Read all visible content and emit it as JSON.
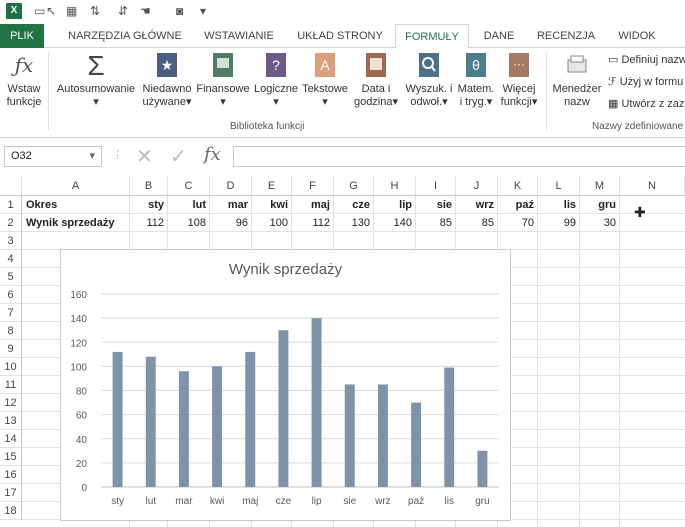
{
  "app": {
    "logo": "X"
  },
  "quick_access": [
    "save-icon",
    "undo-icon",
    "format-icon",
    "sort-asc-icon",
    "sort-desc-icon",
    "touch-icon",
    "camera-icon",
    "customize-icon"
  ],
  "tabs": [
    {
      "label": "PLIK"
    },
    {
      "label": "NARZĘDZIA GŁÓWNE"
    },
    {
      "label": "WSTAWIANIE"
    },
    {
      "label": "UKŁAD STRONY"
    },
    {
      "label": "FORMUŁY"
    },
    {
      "label": "DANE"
    },
    {
      "label": "RECENZJA"
    },
    {
      "label": "WIDOK"
    }
  ],
  "ribbon": {
    "insert_function": {
      "line1": "Wstaw",
      "line2": "funkcje"
    },
    "autosum": {
      "line1": "Autosumowanie"
    },
    "recent": {
      "line1": "Niedawno",
      "line2": "używane"
    },
    "financial": {
      "line1": "Finansowe"
    },
    "logical": {
      "line1": "Logiczne"
    },
    "text": {
      "line1": "Tekstowe"
    },
    "datetime": {
      "line1": "Data i",
      "line2": "godzina"
    },
    "lookup": {
      "line1": "Wyszuk. i",
      "line2": "odwoł."
    },
    "math": {
      "line1": "Matem.",
      "line2": "i tryg."
    },
    "more": {
      "line1": "Więcej",
      "line2": "funkcji"
    },
    "library_group": "Biblioteka funkcji",
    "name_manager": {
      "line1": "Menedżer",
      "line2": "nazw"
    },
    "define_name": "Definiuj nazw",
    "use_in_formula": "Użyj w formu",
    "create_from": "Utwórz z zaz",
    "names_group": "Nazwy zdefiniowane"
  },
  "formula_bar": {
    "name_box": "O32",
    "fx": "fx",
    "value": ""
  },
  "columns": [
    "A",
    "B",
    "C",
    "D",
    "E",
    "F",
    "G",
    "H",
    "I",
    "J",
    "K",
    "L",
    "M",
    "N"
  ],
  "rows": [
    "1",
    "2",
    "3",
    "4",
    "5",
    "6",
    "7",
    "8",
    "9",
    "10",
    "11",
    "12",
    "13",
    "14",
    "15",
    "16",
    "17",
    "18"
  ],
  "sheet": {
    "row1": [
      "Okres",
      "sty",
      "lut",
      "mar",
      "kwi",
      "maj",
      "cze",
      "lip",
      "sie",
      "wrz",
      "paź",
      "lis",
      "gru"
    ],
    "row2": [
      "Wynik sprzedaży",
      "112",
      "108",
      "96",
      "100",
      "112",
      "130",
      "140",
      "85",
      "85",
      "70",
      "99",
      "30"
    ]
  },
  "chart_data": {
    "type": "bar",
    "title": "Wynik sprzedaży",
    "categories": [
      "sty",
      "lut",
      "mar",
      "kwi",
      "maj",
      "cze",
      "lip",
      "sie",
      "wrz",
      "paź",
      "lis",
      "gru"
    ],
    "values": [
      112,
      108,
      96,
      100,
      112,
      130,
      140,
      85,
      85,
      70,
      99,
      30
    ],
    "ylim": [
      0,
      160
    ],
    "yticks": [
      0,
      20,
      40,
      60,
      80,
      100,
      120,
      140,
      160
    ],
    "grid": true,
    "color": "#7f93a8"
  }
}
